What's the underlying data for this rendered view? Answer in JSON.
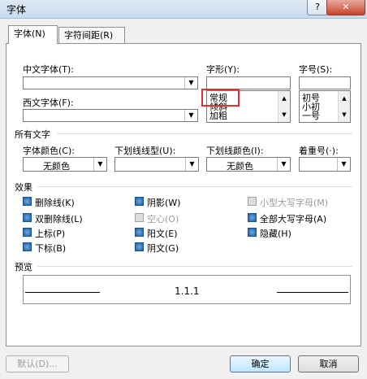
{
  "window": {
    "title": "字体",
    "help": "?",
    "close": "✕"
  },
  "tabs": [
    {
      "label": "字体(N)"
    },
    {
      "label": "字符间距(R)"
    }
  ],
  "font": {
    "chinese_label": "中文字体(T):",
    "chinese_value": "",
    "western_label": "西文字体(F):",
    "western_value": "",
    "style_label": "字形(Y):",
    "style_value": "",
    "style_options": [
      "常规",
      "倾斜",
      "加粗"
    ],
    "size_label": "字号(S):",
    "size_value": "",
    "size_options": [
      "初号",
      "小初",
      "一号"
    ]
  },
  "all_text": {
    "group_label": "所有文字",
    "color_label": "字体颜色(C):",
    "color_value": "无颜色",
    "underline_type_label": "下划线线型(U):",
    "underline_type_value": "",
    "underline_color_label": "下划线颜色(I):",
    "underline_color_value": "无颜色",
    "emphasis_label": "着重号(·):",
    "emphasis_value": ""
  },
  "effects": {
    "group_label": "效果",
    "col1": [
      "删除线(K)",
      "双删除线(L)",
      "上标(P)",
      "下标(B)"
    ],
    "col2": [
      "阴影(W)",
      "空心(O)",
      "阳文(E)",
      "阴文(G)"
    ],
    "col3": [
      "小型大写字母(M)",
      "全部大写字母(A)",
      "隐藏(H)"
    ]
  },
  "preview": {
    "group_label": "预览",
    "sample": "1.1.1"
  },
  "buttons": {
    "default": "默认(D)...",
    "ok": "确定",
    "cancel": "取消"
  },
  "colors": {
    "highlight": "#e0302a",
    "accent": "#2d6cb5"
  }
}
